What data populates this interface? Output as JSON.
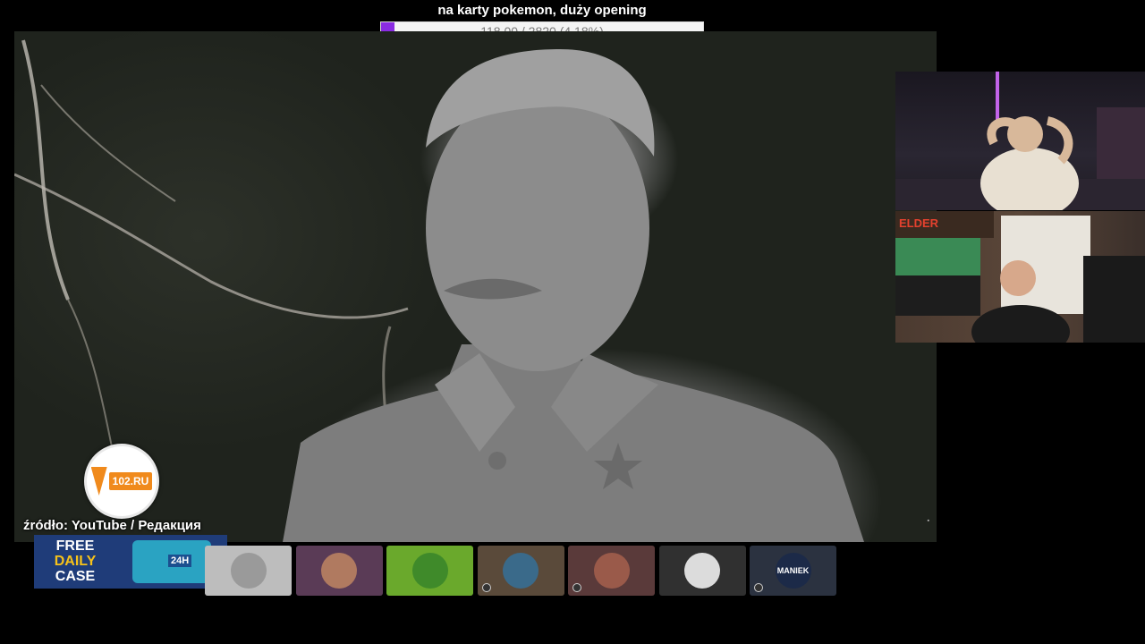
{
  "goal": {
    "title": "na karty pokemon, duży opening",
    "progress_text": "118.00 / 2820 (4.18%)",
    "progress_fraction": 0.0418,
    "fill_color": "#8a2be2"
  },
  "video": {
    "logo_text": "102.RU",
    "source_text": "źródło: YouTube / Редакция"
  },
  "ad": {
    "line1": "FREE",
    "line2": "DAILY",
    "line3": "CASE",
    "box_label": "24H"
  },
  "tiles": [
    {
      "name": "car",
      "bg": "#bdbdbd",
      "avatar_bg": "#9a9a9a",
      "label": "",
      "has_icon": false
    },
    {
      "name": "bald-head",
      "bg": "#5a3b56",
      "avatar_bg": "#b07a60",
      "label": "",
      "has_icon": false
    },
    {
      "name": "pepe",
      "bg": "#6aa92c",
      "avatar_bg": "#3f8a2a",
      "label": "",
      "has_icon": false
    },
    {
      "name": "pixel-character",
      "bg": "#5a4a3a",
      "avatar_bg": "#3a6a8a",
      "label": "",
      "has_icon": true
    },
    {
      "name": "robot",
      "bg": "#5a3a3a",
      "avatar_bg": "#9a5a4a",
      "label": "",
      "has_icon": true
    },
    {
      "name": "woman",
      "bg": "#303030",
      "avatar_bg": "#dcdcdc",
      "label": "",
      "has_icon": false
    },
    {
      "name": "maniek",
      "bg": "#2b3240",
      "avatar_bg": "#1c2a48",
      "label": "MANIEK",
      "has_icon": true
    }
  ]
}
